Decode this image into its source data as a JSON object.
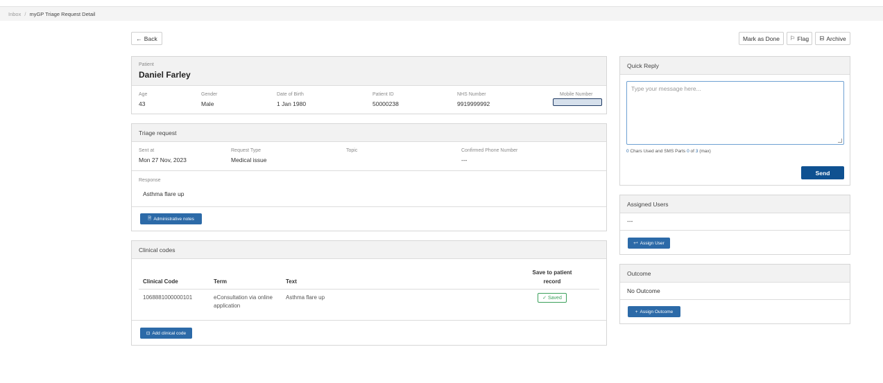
{
  "breadcrumb": {
    "inbox": "Inbox",
    "separator": "/",
    "current": "myGP Triage Request Detail"
  },
  "toolbar": {
    "back_label": "Back",
    "back_icon": "←",
    "mark_done_label": "Mark as Done",
    "flag_label": "Flag",
    "flag_icon": "⚐",
    "archive_label": "Archive",
    "archive_icon": "⊟"
  },
  "patient": {
    "section_label": "Patient",
    "name": "Daniel Farley",
    "fields": {
      "age": {
        "label": "Age",
        "value": "43"
      },
      "gender": {
        "label": "Gender",
        "value": "Male"
      },
      "dob": {
        "label": "Date of Birth",
        "value": "1 Jan 1980"
      },
      "patient_id": {
        "label": "Patient ID",
        "value": "50000238"
      },
      "nhs_number": {
        "label": "NHS Number",
        "value": "9919999992"
      },
      "mobile": {
        "label": "Mobile Number",
        "value": ""
      }
    }
  },
  "triage": {
    "title": "Triage request",
    "sent_at": {
      "label": "Sent at",
      "value": "Mon 27 Nov, 2023"
    },
    "request_type": {
      "label": "Request Type",
      "value": "Medical issue"
    },
    "topic": {
      "label": "Topic",
      "value": ""
    },
    "confirmed_phone": {
      "label": "Confirmed Phone Number",
      "value": "---"
    },
    "response": {
      "label": "Response",
      "value": "Asthma flare up"
    },
    "admin_notes_label": "Administrative notes",
    "admin_notes_icon": "🗎"
  },
  "clinical": {
    "title": "Clinical codes",
    "headers": {
      "code": "Clinical Code",
      "term": "Term",
      "text": "Text",
      "save_line1": "Save to patient",
      "save_line2": "record"
    },
    "rows": [
      {
        "code": "1068881000000101",
        "term_line1": "eConsultation via online",
        "term_line2": "application",
        "text": "Asthma flare up",
        "status": "Saved",
        "status_icon": "✓"
      }
    ],
    "add_label": "Add clinical code",
    "add_icon": "⊡"
  },
  "quick_reply": {
    "title": "Quick Reply",
    "placeholder": "Type your message here...",
    "chars_used": "0",
    "chars_text": "Chars Used and SMS Parts",
    "parts_used": "0",
    "of_text": "of",
    "parts_max": "3",
    "max_text": "(max)",
    "send_label": "Send"
  },
  "assigned": {
    "title": "Assigned Users",
    "value": "---",
    "assign_label": "Assign User",
    "assign_icon": "+⁴"
  },
  "outcome": {
    "title": "Outcome",
    "value": "No Outcome",
    "assign_label": "Assign Outcome",
    "assign_icon": "+"
  },
  "colors": {
    "primary": "#2c6aa8",
    "send": "#0f5191",
    "saved": "#3aa05a"
  }
}
